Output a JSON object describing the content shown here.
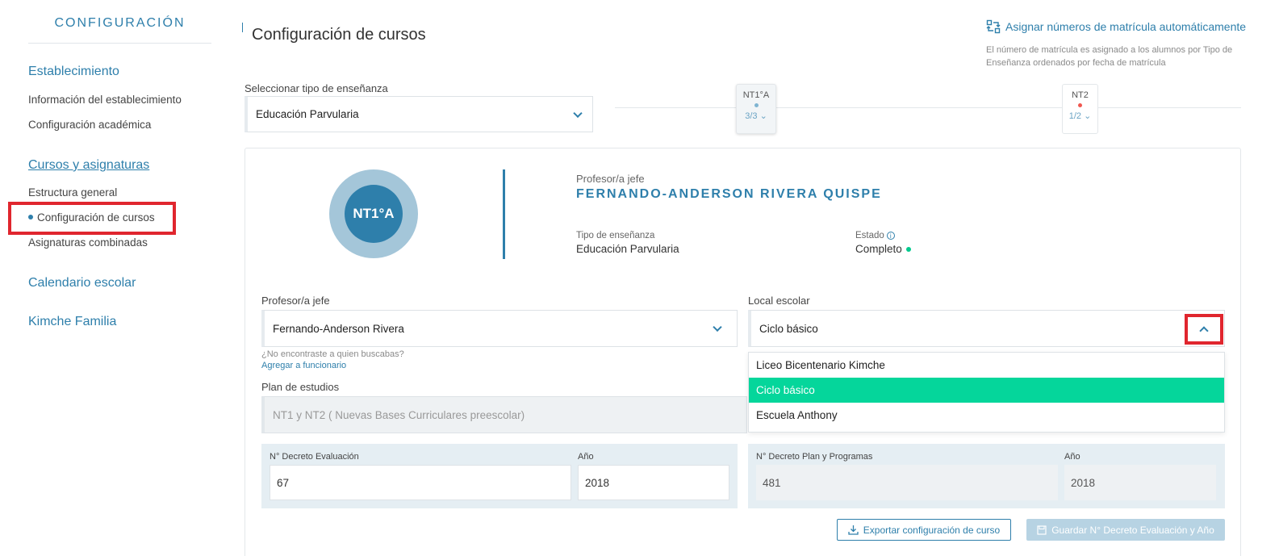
{
  "sidebar": {
    "title": "CONFIGURACIÓN",
    "sections": {
      "establecimiento": "Establecimiento",
      "info_establecimiento": "Información del establecimiento",
      "config_academica": "Configuración académica",
      "cursos_asignaturas": "Cursos y asignaturas",
      "estructura_general": "Estructura general",
      "config_cursos": "Configuración de cursos",
      "asignaturas_combinadas": "Asignaturas combinadas",
      "calendario_escolar": "Calendario escolar",
      "kimche_familia": "Kimche Familia"
    }
  },
  "header": {
    "title": "Configuración de cursos",
    "assign_link": "Asignar números de matrícula automáticamente",
    "assign_desc": "El número de matrícula es asignado a los alumnos por Tipo de Enseñanza ordenados por fecha de matrícula"
  },
  "tipo_ensenanza": {
    "label": "Seleccionar tipo de enseñanza",
    "value": "Educación Parvularia"
  },
  "course_tabs": [
    {
      "name": "NT1°A",
      "count": "3/3",
      "dot_color": "#7fb4d1"
    },
    {
      "name": "NT2",
      "count": "1/2",
      "dot_color": "#f0574f"
    }
  ],
  "course": {
    "badge": "NT1°A",
    "prof_label": "Profesor/a jefe",
    "prof_name": "FERNANDO-ANDERSON RIVERA QUISPE",
    "tipo_label": "Tipo de enseñanza",
    "tipo_value": "Educación Parvularia",
    "estado_label": "Estado",
    "estado_value": "Completo"
  },
  "form": {
    "prof_label": "Profesor/a jefe",
    "prof_value": "Fernando-Anderson Rivera",
    "hint": "¿No encontraste a quien buscabas?",
    "hint_link": "Agregar a funcionario",
    "local_label": "Local escolar",
    "local_value": "Ciclo básico",
    "local_options": [
      "Liceo Bicentenario Kimche",
      "Ciclo básico",
      "Escuela Anthony"
    ],
    "plan_label": "Plan de estudios",
    "plan_value": "NT1 y NT2 ( Nuevas Bases Curriculares preescolar)"
  },
  "decrees": {
    "eval_label": "N° Decreto Evaluación",
    "eval_value": "67",
    "eval_year_label": "Año",
    "eval_year": "2018",
    "plan_label": "N° Decreto Plan y Programas",
    "plan_value": "481",
    "plan_year_label": "Año",
    "plan_year": "2018"
  },
  "buttons": {
    "export": "Exportar configuración de curso",
    "save": "Guardar N° Decreto Evaluación y Año"
  }
}
